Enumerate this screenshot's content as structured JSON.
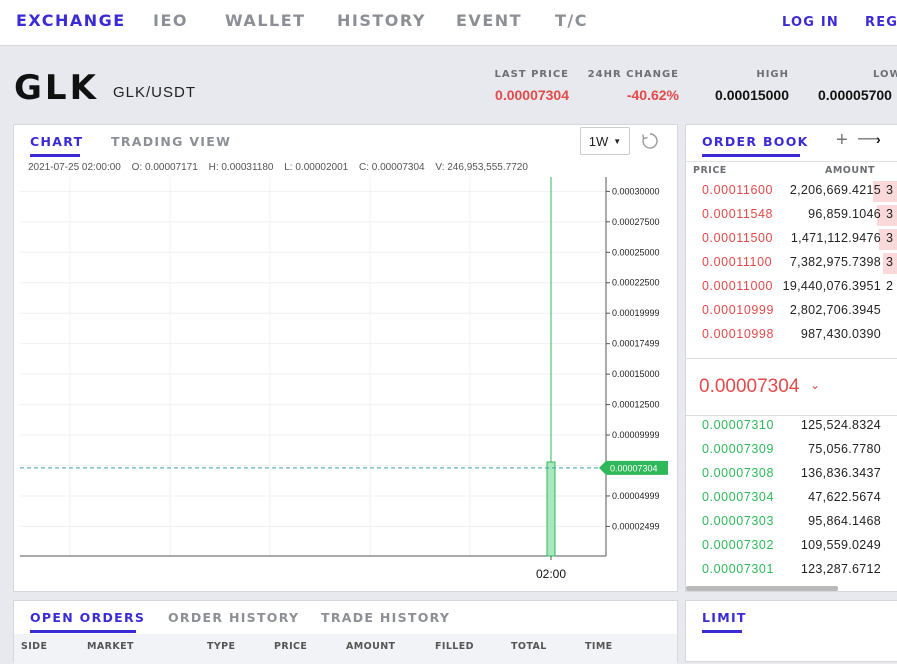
{
  "nav": {
    "items": [
      "EXCHANGE",
      "IEO",
      "WALLET",
      "HISTORY",
      "EVENT",
      "T/C"
    ],
    "login": "LOG IN",
    "register": "REGI"
  },
  "market": {
    "symbol": "GLK",
    "pair": "GLK/USDT",
    "stats": [
      {
        "label": "LAST PRICE",
        "value": "0.00007304",
        "color": "red"
      },
      {
        "label": "24HR CHANGE",
        "value": "-40.62%",
        "color": "red"
      },
      {
        "label": "HIGH",
        "value": "0.00015000",
        "color": "black"
      },
      {
        "label": "LOW",
        "value": "0.00005700",
        "color": "black"
      }
    ]
  },
  "chart_panel": {
    "tabs": [
      "CHART",
      "TRADING VIEW"
    ],
    "timeframe": "1W",
    "ohlc": {
      "time": "2021-07-25 02:00:00",
      "open": "O: 0.00007171",
      "high": "H: 0.00031180",
      "low": "L: 0.00002001",
      "close": "C: 0.00007304",
      "volume": "V: 246,953,555.7720"
    }
  },
  "chart_data": {
    "type": "candlestick",
    "x_tick_labels": [
      "02:00"
    ],
    "y_tick_labels": [
      "0.00030000",
      "0.00027500",
      "0.00025000",
      "0.00022500",
      "0.00019999",
      "0.00017499",
      "0.00015000",
      "0.00012500",
      "0.00009999",
      "0.00007499",
      "0.00004999",
      "0.00002499"
    ],
    "y_ticks": [
      0.0003,
      0.000275,
      0.00025,
      0.000225,
      0.00019999,
      0.00017499,
      0.00015,
      0.000125,
      9.999e-05,
      7.499e-05,
      4.999e-05,
      2.499e-05
    ],
    "ylim": [
      7e-07,
      0.0003118
    ],
    "candles": [
      {
        "time": "2021-07-25 02:00:00",
        "open": 7.171e-05,
        "high": 0.0003118,
        "low": 2.001e-05,
        "close": 7.304e-05
      }
    ],
    "volume_bar": {
      "value": 246953555.772
    },
    "last_price": 7.304e-05,
    "last_price_label": "0.00007304",
    "grid": true,
    "colors": {
      "up": "#2fb85a",
      "up_fill": "#a9e8bd",
      "grid": "#eef0f3",
      "last_line": "#3aa79b",
      "last_tag": "#2fb85a"
    }
  },
  "order_book": {
    "title": "ORDER BOOK",
    "head": {
      "price": "PRICE",
      "amount": "AMOUNT"
    },
    "asks": [
      {
        "price": "0.00011600",
        "amount": "2,206,669.4215",
        "total": "3",
        "depth": 0.12
      },
      {
        "price": "0.00011548",
        "amount": "96,859.1046",
        "total": "3",
        "depth": 0.1
      },
      {
        "price": "0.00011500",
        "amount": "1,471,112.9476",
        "total": "3",
        "depth": 0.09
      },
      {
        "price": "0.00011100",
        "amount": "7,382,975.7398",
        "total": "3",
        "depth": 0.07
      },
      {
        "price": "0.00011000",
        "amount": "19,440,076.3951",
        "total": "2",
        "depth": 0.0
      },
      {
        "price": "0.00010999",
        "amount": "2,802,706.3945",
        "total": "",
        "depth": 0.0
      },
      {
        "price": "0.00010998",
        "amount": "987,430.0390",
        "total": "",
        "depth": 0.0
      }
    ],
    "mid_price": "0.00007304",
    "bids": [
      {
        "price": "0.00007310",
        "amount": "125,524.8324"
      },
      {
        "price": "0.00007309",
        "amount": "75,056.7780"
      },
      {
        "price": "0.00007308",
        "amount": "136,836.3437"
      },
      {
        "price": "0.00007304",
        "amount": "47,622.5674"
      },
      {
        "price": "0.00007303",
        "amount": "95,864.1468"
      },
      {
        "price": "0.00007302",
        "amount": "109,559.0249"
      },
      {
        "price": "0.00007301",
        "amount": "123,287.6712"
      }
    ]
  },
  "orders_panel": {
    "tabs": [
      "OPEN ORDERS",
      "ORDER HISTORY",
      "TRADE HISTORY"
    ],
    "columns": [
      "SIDE",
      "MARKET",
      "TYPE",
      "PRICE",
      "AMOUNT",
      "FILLED",
      "TOTAL",
      "TIME"
    ]
  },
  "limit_panel": {
    "tab": "LIMIT"
  }
}
